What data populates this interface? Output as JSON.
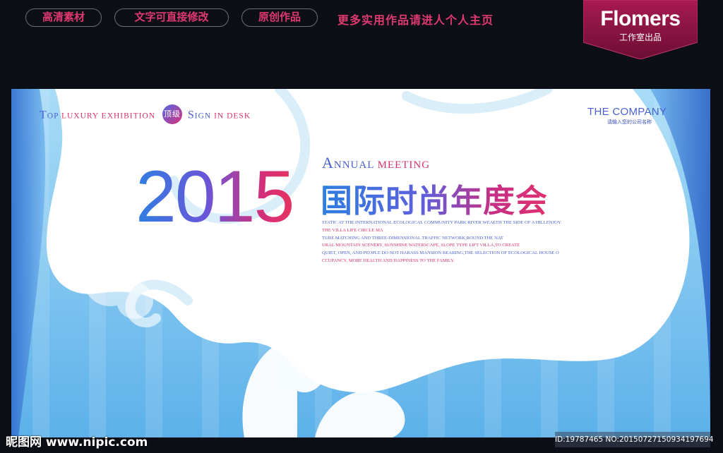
{
  "top_bar": {
    "buttons": [
      "高清素材",
      "文字可直接修改",
      "原创作品"
    ],
    "tagline": "更多实用作品请进人个人主页",
    "brand": {
      "name": "Flomers",
      "subtitle": "工作室出品"
    }
  },
  "poster": {
    "top_left": {
      "t_cap": "T",
      "t_rest": "OP",
      "luxury": "LUXURY",
      "exhibition": "EXHIBITION",
      "badge": "顶级",
      "s_cap": "S",
      "s_rest": "IGN",
      "in_desk": "IN  DESK"
    },
    "company": "THE COMPANY",
    "company_sub": "请输入您的公司名称",
    "annual": {
      "a_cap": "A",
      "a_rest": "NNUAL",
      "meeting": "MEETING"
    },
    "year": "2015",
    "title_cn": "国际时尚年度会",
    "body_lines": [
      "STATIC AT THE INTERNATIONAL ECOLOGICAL COMMUNITY PARK RIVER WEALTH THE SIDE OF A HILLENJOY",
      "THE VILLA LIFE CIRCLE MA",
      "TURE MATCHING AND THREE-DIMENSIONAL TRAFFIC NETWORK,ROUND THE NAT",
      "URAL MOUNTAIN SCENERY, SUNSHINE WATERSCAPE, SLOPE TYPE LIFT VILLA,TO CREATE",
      "QUIET, OPEN, AND PEOPLE DO NOT HARASS MANSION BEARING,THE SELECTION OF ECOLOGICAL HOUSE O",
      "CCUPANCY, MORE HEALTH AND HAPPINESS TO THE FAMILY."
    ],
    "colors": {
      "blue": "#4a5fd0",
      "pink": "#d8336b",
      "sky": "#7ec4ef"
    }
  },
  "watermark": {
    "site": "昵图网 www.nipic.com",
    "id_text": "ID:19787465 NO:20150727150934197694"
  }
}
